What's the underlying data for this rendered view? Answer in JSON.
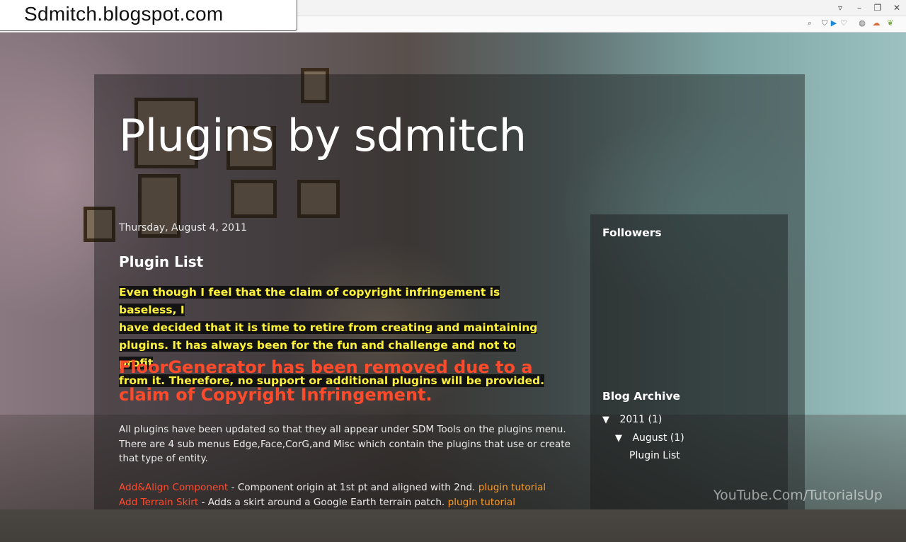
{
  "overlay_url": "Sdmitch.blogspot.com",
  "browser": {
    "window_controls": [
      "▿",
      "–",
      "❐",
      "✕"
    ],
    "addr_icons": [
      "search-icon",
      "shield-icon",
      "play-icon",
      "heart-icon",
      "globe-icon",
      "cloud-icon",
      "leaf-icon"
    ]
  },
  "blog": {
    "title": "Plugins by sdmitch",
    "post": {
      "date": "Thursday, August 4, 2011",
      "title": "Plugin List",
      "notice_lines": [
        "Even though I feel that the claim of copyright infringement is baseless, I",
        "have decided that it is time to retire from creating and maintaining",
        "plugins.  It has always been for the fun and challenge and not to profit",
        "from it.  Therefore, no support or additional plugins will be provided."
      ],
      "removed_text": "FloorGenerator has been removed due to a claim of Copyright Infringement.",
      "intro_text": "All plugins have been updated so that they all appear under SDM Tools on the plugins menu.  There are 4 sub menus Edge,Face,CorG,and Misc which contain the plugins that use or create that type of entity.",
      "plugins": [
        {
          "name": "Add&Align Component",
          "desc": " - Component origin at 1st pt and aligned with 2nd. ",
          "link": "plugin tutorial"
        },
        {
          "name": "Add Terrain Skirt",
          "desc": " - Adds a skirt around a Google Earth terrain patch. ",
          "link": "plugin tutorial"
        }
      ]
    }
  },
  "sidebar": {
    "followers_heading": "Followers",
    "archive_heading": "Blog Archive",
    "archive": {
      "year": {
        "arrow": "▼",
        "label": "2011",
        "count": "(1)"
      },
      "month": {
        "arrow": "▼",
        "label": "August",
        "count": "(1)"
      },
      "post": "Plugin List"
    }
  },
  "watermark": "YouTube.Com/TutorialsUp"
}
